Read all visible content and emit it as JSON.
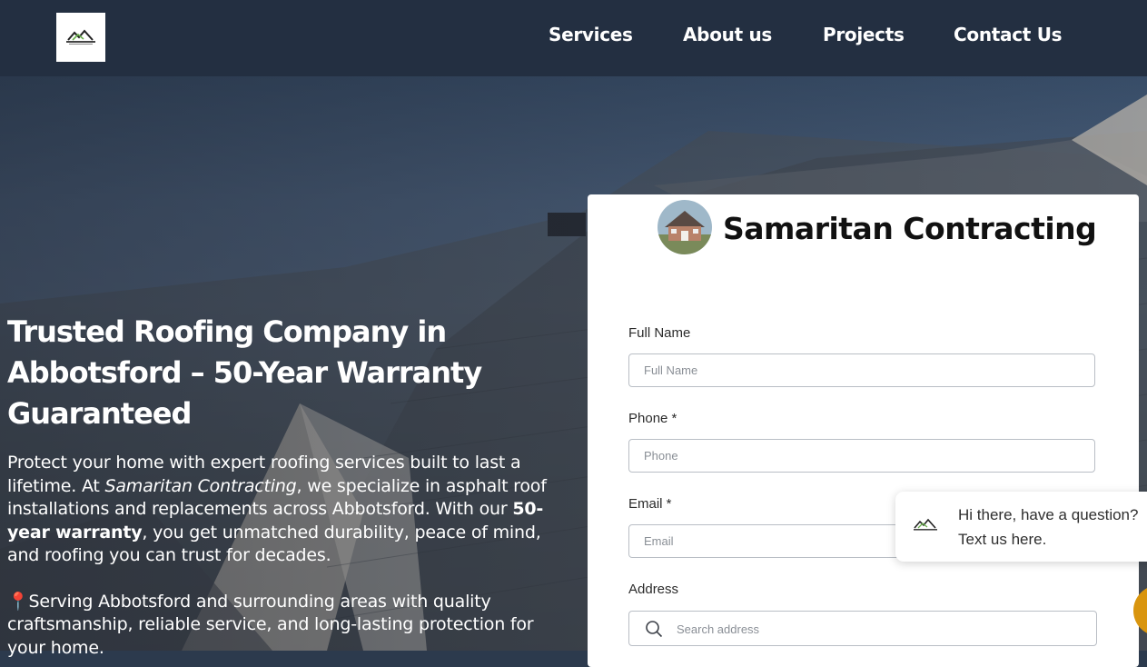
{
  "nav": {
    "items": [
      {
        "label": "Services"
      },
      {
        "label": "About us"
      },
      {
        "label": "Projects"
      },
      {
        "label": "Contact Us"
      }
    ]
  },
  "hero": {
    "title": "Trusted Roofing Company in Abbotsford – 50-Year Warranty Guaranteed",
    "paragraph1": {
      "part1": "Protect your home with expert roofing services built to last a lifetime. At ",
      "company": "Samaritan Contracting",
      "part2": ", we specialize in asphalt roof installations and replacements across Abbotsford. With our ",
      "warranty": "50-year warranty",
      "part3": ", you get unmatched durability, peace of mind, and roofing you can trust for decades."
    },
    "paragraph2": {
      "pin": "📍",
      "text": "Serving Abbotsford and surrounding areas with quality craftsmanship, reliable service, and long-lasting protection for your home."
    }
  },
  "form": {
    "brand_name": "Samaritan Contracting",
    "full_name": {
      "label": "Full Name",
      "placeholder": "Full Name"
    },
    "phone": {
      "label": "Phone *",
      "placeholder": "Phone"
    },
    "email": {
      "label": "Email *",
      "placeholder": "Email"
    },
    "address": {
      "label": "Address",
      "placeholder": "Search address"
    }
  },
  "chat": {
    "line1": "Hi there, have a question?",
    "line2": "Text us here."
  },
  "colors": {
    "nav_bg": "#232f41",
    "chat_button": "#d9950e"
  }
}
